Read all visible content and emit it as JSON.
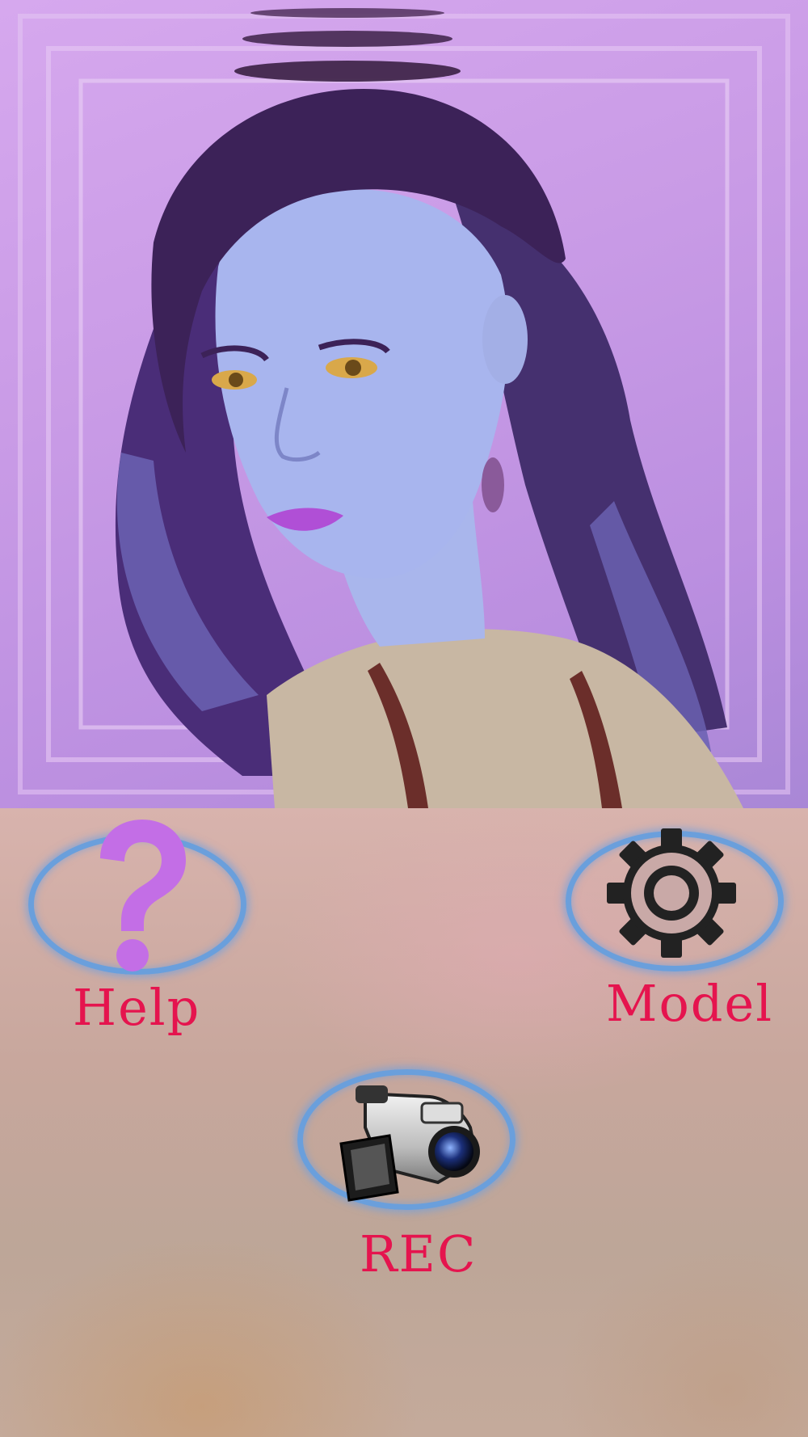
{
  "photo": {
    "description_icon": "portrait-photo",
    "tint": "#c99be6"
  },
  "buttons": {
    "help": {
      "label": "Help",
      "icon": "question-mark-icon"
    },
    "model": {
      "label": "Model",
      "icon": "gear-icon"
    },
    "rec": {
      "label": "REC",
      "icon": "camcorder-icon"
    }
  },
  "colors": {
    "label": "#e5144e",
    "ring": "#6a9fdc",
    "help_icon": "#c36ee6"
  }
}
